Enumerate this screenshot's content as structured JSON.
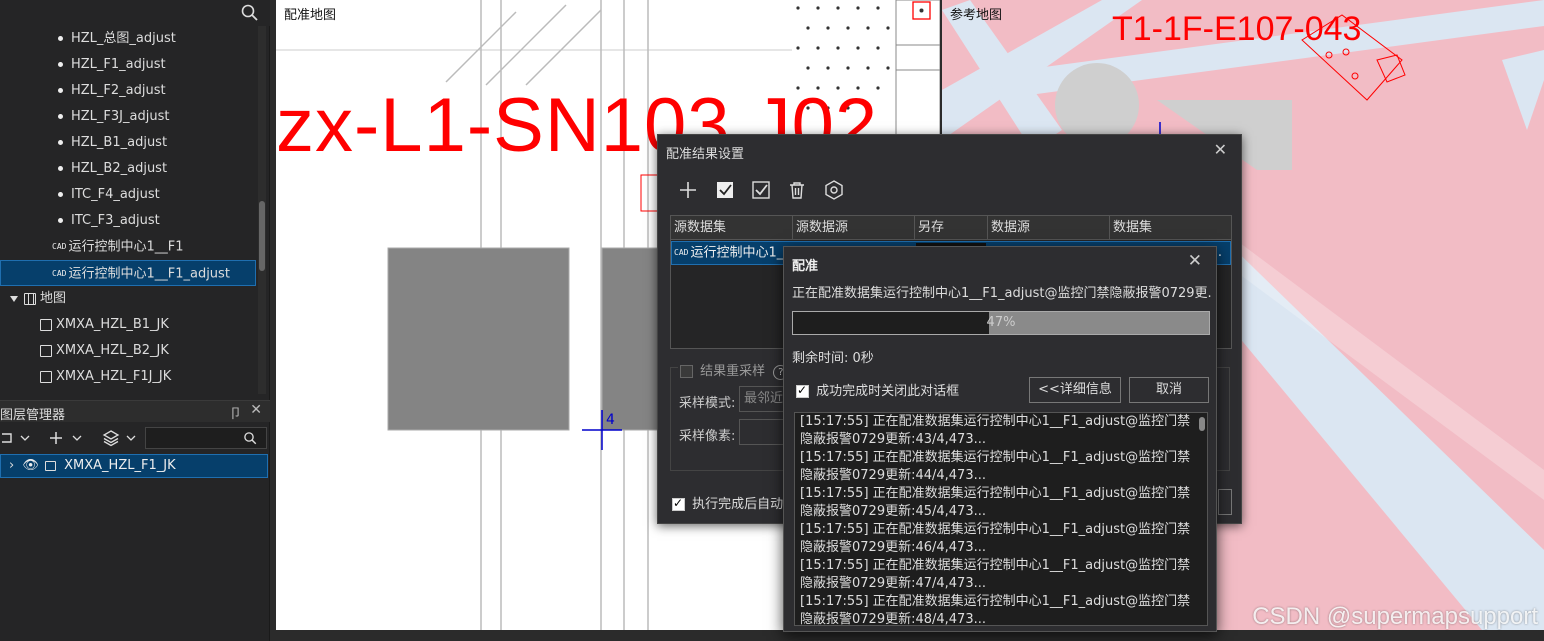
{
  "tree": {
    "items": [
      {
        "label": "HZL_总图_adjust",
        "kind": "bullet"
      },
      {
        "label": "HZL_F1_adjust",
        "kind": "bullet"
      },
      {
        "label": "HZL_F2_adjust",
        "kind": "bullet"
      },
      {
        "label": "HZL_F3J_adjust",
        "kind": "bullet"
      },
      {
        "label": "HZL_B1_adjust",
        "kind": "bullet"
      },
      {
        "label": "HZL_B2_adjust",
        "kind": "bullet"
      },
      {
        "label": "ITC_F4_adjust",
        "kind": "bullet"
      },
      {
        "label": "ITC_F3_adjust",
        "kind": "bullet"
      },
      {
        "label": "运行控制中心1__F1",
        "kind": "cad"
      },
      {
        "label": "运行控制中心1__F1_adjust",
        "kind": "cad",
        "selected": true
      },
      {
        "label": "地图",
        "kind": "map-group"
      },
      {
        "label": "XMXA_HZL_B1_JK",
        "kind": "map"
      },
      {
        "label": "XMXA_HZL_B2_JK",
        "kind": "map"
      },
      {
        "label": "XMXA_HZL_F1J_JK",
        "kind": "map"
      }
    ],
    "cad_tag": "CAD"
  },
  "layer_manager": {
    "title": "图层管理器",
    "pin": "卩",
    "close": "✕",
    "layer": "XMXA_HZL_F1_JK"
  },
  "map_left": {
    "label": "配准地图",
    "big_text": "zx-L1-SN103 J02",
    "cross_label": "4"
  },
  "map_right": {
    "label": "参考地图",
    "big_text": "T1-1F-E107-043"
  },
  "dialog_settings": {
    "title": "配准结果设置",
    "columns": [
      "源数据集",
      "源数据源",
      "另存",
      "数据源",
      "数据集"
    ],
    "row_first_cell": "运行控制中心1_...",
    "row_last_cell": "...",
    "resample_label": "结果重采样",
    "help": "?",
    "sample_mode_label": "采样模式:",
    "sample_mode_value": "最邻近",
    "sample_pixel_label": "采样像素:",
    "auto_label": "执行完成后自动"
  },
  "dialog_progress": {
    "title": "配准",
    "message": "正在配准数据集运行控制中心1__F1_adjust@监控门禁隐蔽报警0729更...",
    "progress": 47,
    "progress_label": "47%",
    "remaining": "剩余时间: 0秒",
    "close_on_success": "成功完成时关闭此对话框",
    "detail_button": "<<详细信息",
    "cancel_button": "取消",
    "log": [
      "[15:17:55] 正在配准数据集运行控制中心1__F1_adjust@监控门禁隐蔽报警0729更新:43/4,473...",
      "[15:17:55] 正在配准数据集运行控制中心1__F1_adjust@监控门禁隐蔽报警0729更新:44/4,473...",
      "[15:17:55] 正在配准数据集运行控制中心1__F1_adjust@监控门禁隐蔽报警0729更新:45/4,473...",
      "[15:17:55] 正在配准数据集运行控制中心1__F1_adjust@监控门禁隐蔽报警0729更新:46/4,473...",
      "[15:17:55] 正在配准数据集运行控制中心1__F1_adjust@监控门禁隐蔽报警0729更新:47/4,473...",
      "[15:17:55] 正在配准数据集运行控制中心1__F1_adjust@监控门禁隐蔽报警0729更新:48/4,473..."
    ]
  },
  "watermark": "CSDN @supermapsupport",
  "colors": {
    "accent": "#063f6b",
    "map_red": "#ff0000",
    "reference_bg": "#f2bcc5"
  }
}
